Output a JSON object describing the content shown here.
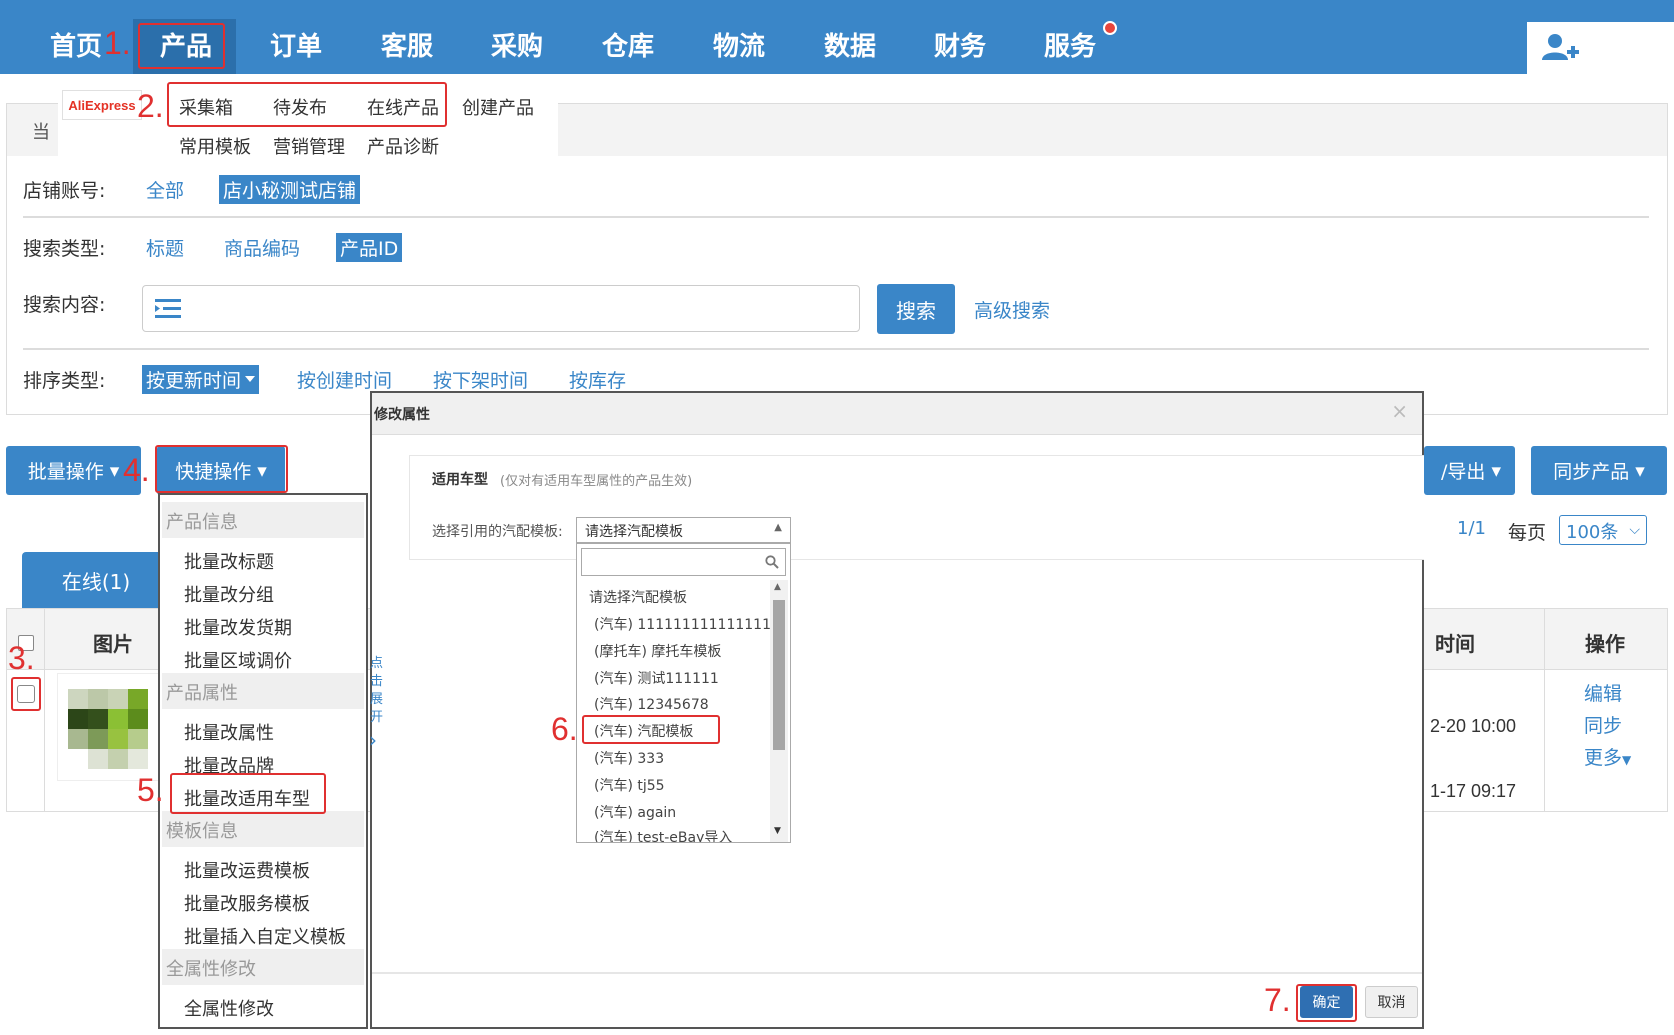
{
  "nav": {
    "items": [
      "首页",
      "产品",
      "订单",
      "客服",
      "采购",
      "仓库",
      "物流",
      "数据",
      "财务",
      "服务"
    ]
  },
  "submenu": {
    "platform": "AliExpress",
    "links": [
      "采集箱",
      "待发布",
      "在线产品",
      "创建产品",
      "常用模板",
      "营销管理",
      "产品诊断"
    ]
  },
  "filters": {
    "store_label": "店铺账号:",
    "store_options": [
      "全部",
      "店小秘测试店铺"
    ],
    "search_type_label": "搜索类型:",
    "search_type_options": [
      "标题",
      "商品编码",
      "产品ID"
    ],
    "search_content_label": "搜索内容:",
    "search_button": "搜索",
    "advanced_search": "高级搜索",
    "sort_label": "排序类型:",
    "sort_options": [
      "按更新时间",
      "按创建时间",
      "按下架时间",
      "按库存"
    ]
  },
  "toolbar": {
    "batch_ops": "批量操作",
    "quick_ops": "快捷操作",
    "import_export": "/导出",
    "sync_products": "同步产品"
  },
  "pagination": {
    "page": "1/1",
    "per_page_label": "每页",
    "per_page": "100条"
  },
  "tabs": {
    "online": "在线(1)"
  },
  "table": {
    "col_image": "图片",
    "col_time": "时间",
    "col_actions": "操作",
    "time_1": "2-20 10:00",
    "time_2": "1-17 09:17",
    "actions": [
      "编辑",
      "同步",
      "更多"
    ]
  },
  "quick_menu": {
    "group_product_info": "产品信息",
    "product_info_items": [
      "批量改标题",
      "批量改分组",
      "批量改发货期",
      "批量区域调价"
    ],
    "group_product_attr": "产品属性",
    "product_attr_items": [
      "批量改属性",
      "批量改品牌",
      "批量改适用车型"
    ],
    "group_template_info": "模板信息",
    "template_items": [
      "批量改运费模板",
      "批量改服务模板",
      "批量插入自定义模板"
    ],
    "group_all_attr": "全属性修改",
    "all_attr_items": [
      "全属性修改"
    ]
  },
  "modal": {
    "title": "修改属性",
    "section_title": "适用车型",
    "section_note": "(仅对有适用车型属性的产品生效)",
    "select_label": "选择引用的汽配模板:",
    "select_placeholder": "请选择汽配模板",
    "options": [
      "请选择汽配模板",
      "(汽车) 1111111111111111",
      "(摩托车) 摩托车模板",
      "(汽车) 测试111111",
      "(汽车) 12345678",
      "(汽车) 汽配模板",
      "(汽车) 333",
      "(汽车) tj55",
      "(汽车) again",
      "(汽车) test-eBay导入"
    ],
    "side_hint": "点击展开",
    "confirm": "确定",
    "cancel": "取消"
  },
  "steps": [
    "1.",
    "2.",
    "3.",
    "4.",
    "5.",
    "6.",
    "7."
  ],
  "colors": {
    "brand": "#3a86c8",
    "annotation": "#e03030"
  }
}
